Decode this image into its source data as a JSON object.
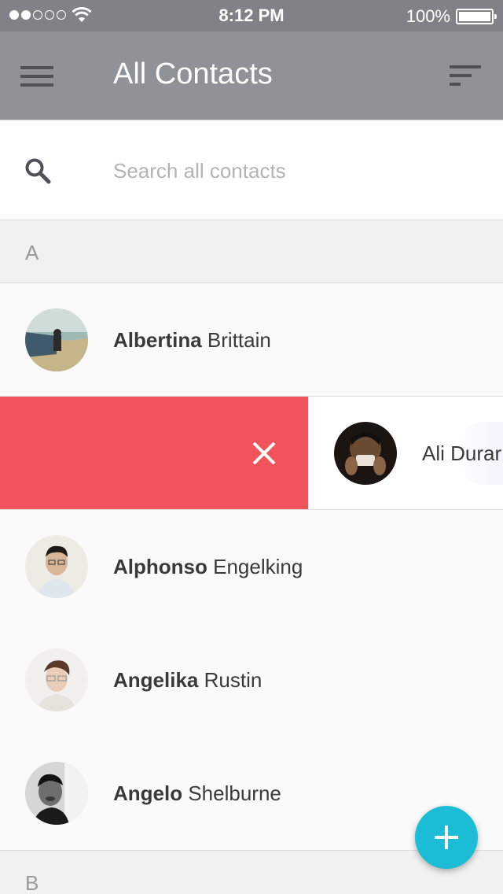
{
  "status_bar": {
    "time": "8:12 PM",
    "battery": "100%",
    "signal_bars_filled": 2,
    "signal_bars_total": 5,
    "icons": [
      "signal-dots-icon",
      "wifi-icon",
      "battery-icon"
    ]
  },
  "header": {
    "title": "All Contacts",
    "left_icon": "menu-icon",
    "right_icon": "sort-icon"
  },
  "search": {
    "placeholder": "Search all contacts",
    "value": "",
    "icon": "search-icon"
  },
  "sections": [
    {
      "letter": "A",
      "contacts": [
        {
          "first": "Albertina",
          "last": "Brittain"
        },
        {
          "first": "Ali",
          "last": "Durar",
          "swiped": true
        },
        {
          "first": "Alphonso",
          "last": "Engelking"
        },
        {
          "first": "Angelika",
          "last": "Rustin"
        },
        {
          "first": "Angelo",
          "last": "Shelburne"
        }
      ]
    },
    {
      "letter": "B",
      "contacts": []
    }
  ],
  "swipe_action": {
    "icon": "close-icon",
    "color": "#f2545c"
  },
  "fab": {
    "icon": "plus-icon",
    "color": "#1bbcd6"
  },
  "colors": {
    "status_bar": "#7f8388",
    "nav_bar": "#8f9297",
    "delete": "#f2545c",
    "accent": "#1bbcd6"
  }
}
